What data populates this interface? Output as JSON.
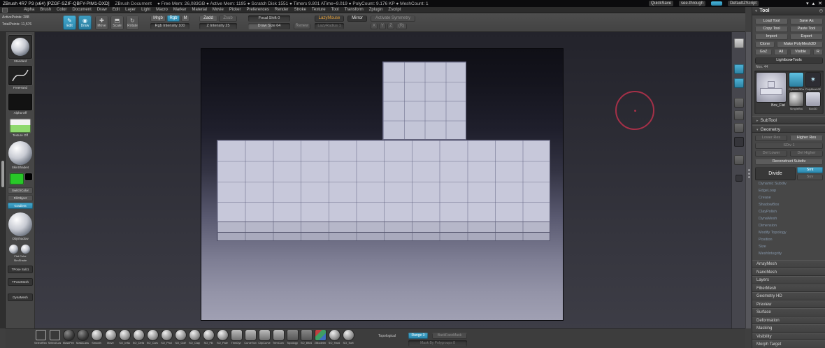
{
  "titlebar": {
    "app": "ZBrush 4R7 P3 (x64) [PZGF-SZIF-QBFY-PIM1-DXD]",
    "doc_title": "ZBrush Document",
    "stats": "● Free Mem: 26,083GB ● Active Mem: 1195 ● Scratch Disk 1551 ● Timers 9.801  ATime=9.019 ● PolyCount: 9.176 KP ● MeshCount: 1",
    "quicksave": "QuickSave",
    "see_through": "see-through",
    "default_zscript": "DefaultZScript",
    "window": {
      "minimize": "▾",
      "maximize": "▴",
      "close": "✕"
    }
  },
  "menubar": {
    "items": [
      "Alpha",
      "Brush",
      "Color",
      "Document",
      "Draw",
      "Edit",
      "Layer",
      "Light",
      "Macro",
      "Marker",
      "Material",
      "Movie",
      "Picker",
      "Preferences",
      "Render",
      "Stroke",
      "Texture",
      "Tool",
      "Transform",
      "Zplugin",
      "Zscript"
    ]
  },
  "toolbar": {
    "active_points": "ActivePoints: 288",
    "total_points": "TotalPoints: 11,576",
    "edit": "Edit",
    "draw": "Draw",
    "move": "Move",
    "scale": "Scale",
    "rotate": "Rotate",
    "mrgb": "Mrgb",
    "rgb": "Rgb",
    "m": "M",
    "rgb_intensity": "Rgb Intensity 100",
    "zadd": "Zadd",
    "zsub": "Zsub",
    "z_intensity": "Z Intensity 25",
    "focal_shift": "Focal Shift 0",
    "draw_size": "Draw Size 64",
    "renew": "Renew",
    "lazymouse": "LazyMouse",
    "lazy_radius": "LazyRadius 1",
    "mirror": "Mirror",
    "activate_symmetry": "Activate Symmetry",
    "sym_x": "X",
    "sym_y": "Y",
    "sym_z": "Z",
    "sym_r": "(R)"
  },
  "left_shelf": {
    "brush_label": "Standard",
    "stroke_label": "FreeHand",
    "alpha_label": "Alpha Off",
    "texture_label": "Texture Off",
    "material_label": "SkinShade4",
    "switch_color": "SwitchColor",
    "fill_object": "FillObject",
    "gradient": "Gradient",
    "material2_label": "ObjShadow",
    "flat_label": "Flat Color",
    "shade_label": "SknShade",
    "tpose_sub": "TPose Sub1",
    "tpose_mesh": "TPoseMesh",
    "dynamesh": "DynaMesh"
  },
  "tool_panel": {
    "title": "Tool",
    "buttons": {
      "load_tool": "Load Tool",
      "save_as": "Save As",
      "copy_tool": "Copy Tool",
      "paste_tool": "Paste Tool",
      "import": "Import",
      "export": "Export",
      "clone": "Clone",
      "make_polymesh3d": "Make PolyMesh3D",
      "goz": "GoZ",
      "all": "All",
      "visible": "Visible",
      "r": "R",
      "lightbox_tools": "Lightbox▸Tools",
      "nos": "Nos. 44"
    },
    "inventory": {
      "current_label": "Box_Flat",
      "items": [
        "Cylinder3Da",
        "PolyMesh3D",
        "SimpleBru",
        "Box3D"
      ]
    },
    "subtool_header": "SubTool",
    "geometry_header": "Geometry",
    "geometry": {
      "lower_res": "Lower Res",
      "higher_res": "Higher Res",
      "sdiv": "SDiv 1",
      "del_lower": "Del Lower",
      "del_higher": "Del Higher",
      "reconstruct": "Reconstruct Subdiv",
      "divide": "Divide",
      "smt": "Smt",
      "suv": "Suv",
      "subsections": [
        "Dynamic Subdiv",
        "EdgeLoop",
        "Crease",
        "ShadowBox",
        "ClayPolish",
        "DynaMesh",
        "Dimension",
        "Modify Topology",
        "Position",
        "Size",
        "MeshIntegrity"
      ]
    },
    "collapsed_sections": [
      "ArrayMesh",
      "NanoMesh",
      "Layers",
      "FiberMesh",
      "Geometry HD",
      "Preview",
      "Surface",
      "Deformation",
      "Masking",
      "Visibility",
      "Morph Target"
    ]
  },
  "bottom_bar": {
    "brushes": [
      {
        "label": "SelectRec"
      },
      {
        "label": "Select/Las"
      },
      {
        "label": "MaskPen"
      },
      {
        "label": "MaskLass"
      },
      {
        "label": "Smooth"
      },
      {
        "label": "Move"
      },
      {
        "label": "SO_Infla"
      },
      {
        "label": "SO_Defa"
      },
      {
        "label": "SO_Carv"
      },
      {
        "label": "SO_Pncl"
      },
      {
        "label": "SO_Golf"
      },
      {
        "label": "SO_Clay"
      },
      {
        "label": "SO_FB"
      },
      {
        "label": "SO_Pale"
      },
      {
        "label": "TrimDyn"
      },
      {
        "label": "CurveTub"
      },
      {
        "label": "ClipCurve"
      },
      {
        "label": "TrimCurv"
      },
      {
        "label": "Topology"
      },
      {
        "label": "SO_BM4"
      },
      {
        "label": "ZModeler"
      },
      {
        "label": "SO_Hard"
      },
      {
        "label": "SO_Soft"
      }
    ],
    "topological": "Topological",
    "range": "Range 3",
    "backfacemask": "BackFaceMask",
    "mask_by_polygroups": "Mask By Polygroups 8"
  },
  "colors": {
    "accent_teal": "#3ba0c6",
    "accent_orange": "#e5a33f",
    "swatch_main": "#28c828",
    "swatch_secondary": "#000000",
    "cursor_ring": "#a53048"
  }
}
